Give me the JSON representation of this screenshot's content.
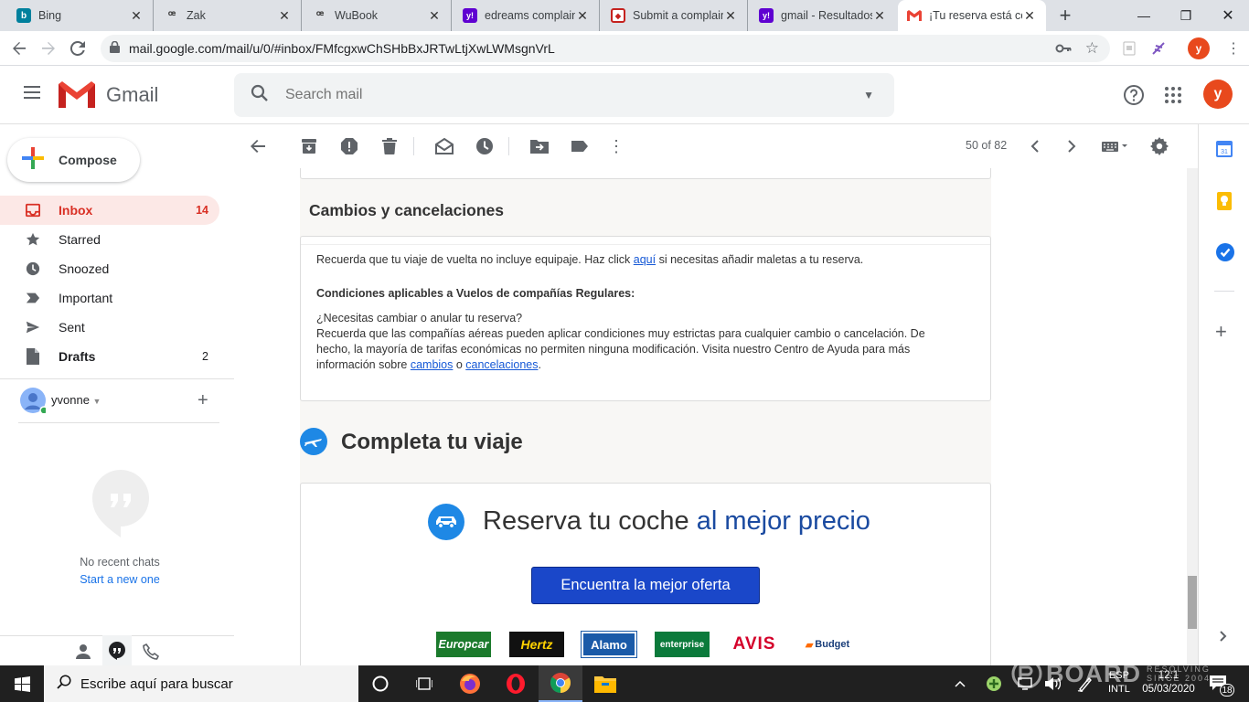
{
  "browser": {
    "tabs": [
      {
        "title": "Bing",
        "color": "#00809d",
        "glyph": "b"
      },
      {
        "title": "Zak",
        "color": "#555555",
        "glyph": "Ƶ"
      },
      {
        "title": "WuBook",
        "color": "#555555",
        "glyph": "Ƶ"
      },
      {
        "title": "edreams complain",
        "color": "#5f01d1",
        "glyph": "y!"
      },
      {
        "title": "Submit a complain",
        "color": "#c5221f",
        "glyph": "⛉"
      },
      {
        "title": "gmail - Resultados",
        "color": "#5f01d1",
        "glyph": "y!"
      },
      {
        "title": "¡Tu reserva está co",
        "color": "#ffffff",
        "glyph": "M"
      }
    ],
    "url": "mail.google.com/mail/u/0/#inbox/FMfcgxwChSHbBxJRTwLtjXwLWMsgnVrL",
    "avatar_letter": "y"
  },
  "gmail": {
    "logo_text": "Gmail",
    "search_placeholder": "Search mail",
    "account_letter": "y",
    "compose_label": "Compose",
    "nav": [
      {
        "label": "Inbox",
        "count": "14"
      },
      {
        "label": "Starred",
        "count": ""
      },
      {
        "label": "Snoozed",
        "count": ""
      },
      {
        "label": "Important",
        "count": ""
      },
      {
        "label": "Sent",
        "count": ""
      },
      {
        "label": "Drafts",
        "count": "2"
      }
    ],
    "hangouts_user": "yvonne",
    "no_chats": "No recent chats",
    "start_new": "Start a new one",
    "pagination": "50 of 82"
  },
  "email": {
    "section_title": "Cambios y cancelaciones",
    "p1_before": "Recuerda que tu viaje de vuelta no incluye equipaje. Haz click ",
    "p1_link": "aquí",
    "p1_after": " si necesitas añadir maletas a tu reserva.",
    "conditions_heading": "Condiciones aplicables a Vuelos de compañías Regulares:",
    "question": "¿Necesitas cambiar o anular tu reserva?",
    "p2_before": "Recuerda que las compañías aéreas pueden aplicar condiciones muy estrictas para cualquier cambio o cancelación. De hecho, la mayoría de tarifas económicas no permiten ninguna modificación. Visita nuestro Centro de Ayuda para más información sobre ",
    "p2_link1": "cambios",
    "p2_mid": " o ",
    "p2_link2": "cancelaciones",
    "p2_end": ".",
    "complete_trip": "Completa tu viaje",
    "car_title_a": "Reserva tu coche ",
    "car_title_b": "al mejor precio",
    "car_button": "Encuentra la mejor oferta",
    "brands": [
      "Europcar",
      "Hertz",
      "Alamo",
      "enterprise",
      "AVIS",
      "Budget"
    ]
  },
  "taskbar": {
    "search_text": "Escribe aquí para buscar",
    "lang1": "ESP",
    "lang2": "INTL",
    "time": "12:1",
    "date": "05/03/2020",
    "notif_count": "18",
    "watermark_brand": "BOARD",
    "watermark_line1": "RESOLVING",
    "watermark_line2": "SINCE 2004"
  }
}
